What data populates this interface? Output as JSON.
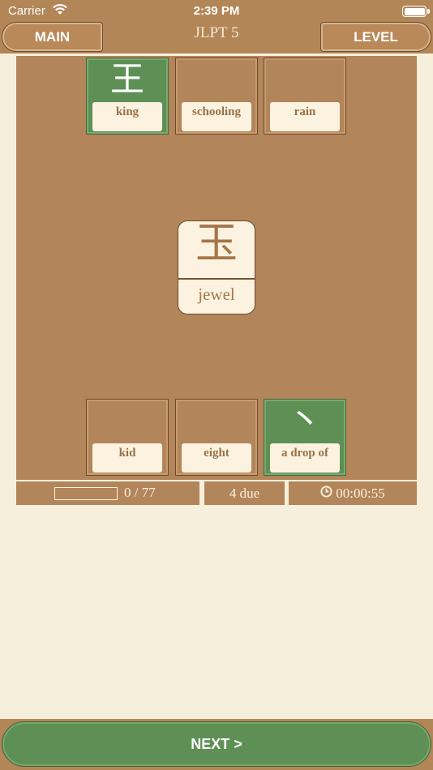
{
  "status_bar": {
    "carrier": "Carrier",
    "time": "2:39 PM",
    "battery_level": 1.0
  },
  "header": {
    "main_button": "MAIN",
    "title": "JLPT 5",
    "level_button": "LEVEL"
  },
  "top_cards": [
    {
      "kanji": "王",
      "meaning": "king",
      "matched": true
    },
    {
      "kanji": "",
      "meaning": "schooling",
      "matched": false
    },
    {
      "kanji": "",
      "meaning": "rain",
      "matched": false
    }
  ],
  "center_card": {
    "kanji": "玉",
    "meaning": "jewel"
  },
  "bottom_cards": [
    {
      "kanji": "",
      "meaning": "kid",
      "matched": false
    },
    {
      "kanji": "",
      "meaning": "eight",
      "matched": false
    },
    {
      "kanji": "丶",
      "meaning": "a drop of",
      "matched": true
    }
  ],
  "info": {
    "progress_fraction": 0,
    "progress_text": "0 / 77",
    "due_text": "4 due",
    "timer": "00:00:55"
  },
  "footer": {
    "next_button": "NEXT >"
  },
  "colors": {
    "wood": "#b3855a",
    "paper": "#f6efdc",
    "green": "#5e8f55"
  }
}
